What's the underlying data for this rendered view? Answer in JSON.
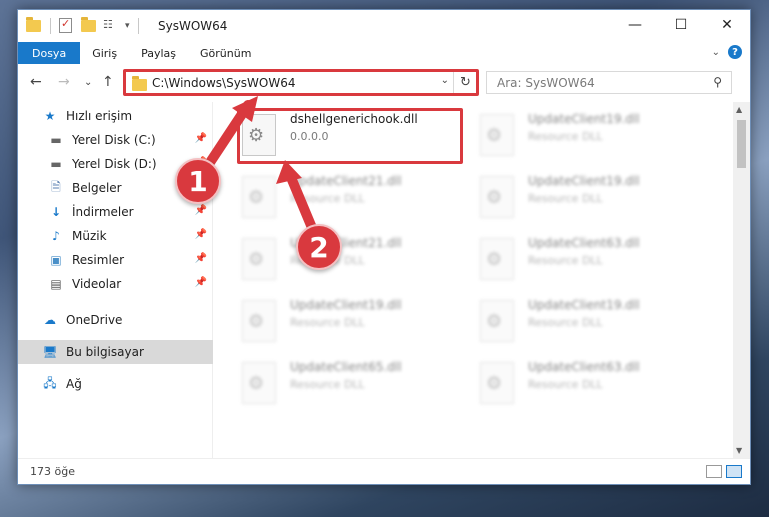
{
  "window": {
    "title": "SysWOW64",
    "minimize": "—",
    "maximize": "☐",
    "close": "✕"
  },
  "ribbon": {
    "tabs": [
      "Dosya",
      "Giriş",
      "Paylaş",
      "Görünüm"
    ]
  },
  "nav": {
    "back": "←",
    "forward": "→",
    "recent": "⌄",
    "up": "↑",
    "address": "C:\\Windows\\SysWOW64",
    "search_placeholder": "Ara: SysWOW64"
  },
  "sidebar": {
    "items": [
      {
        "label": "Hızlı erişim",
        "icon": "star-icon"
      },
      {
        "label": "Yerel Disk (C:)",
        "icon": "drive-icon",
        "pinned": true
      },
      {
        "label": "Yerel Disk (D:)",
        "icon": "drive-icon",
        "pinned": true
      },
      {
        "label": "Belgeler",
        "icon": "documents-icon",
        "pinned": true
      },
      {
        "label": "İndirmeler",
        "icon": "download-icon",
        "pinned": true
      },
      {
        "label": "Müzik",
        "icon": "music-icon",
        "pinned": true
      },
      {
        "label": "Resimler",
        "icon": "pictures-icon",
        "pinned": true
      },
      {
        "label": "Videolar",
        "icon": "videos-icon",
        "pinned": true
      },
      {
        "label": "OneDrive",
        "icon": "cloud-icon"
      },
      {
        "label": "Bu bilgisayar",
        "icon": "computer-icon",
        "selected": true
      },
      {
        "label": "Ağ",
        "icon": "network-icon"
      }
    ]
  },
  "files": {
    "highlighted": {
      "name": "dshellgenerichook.dll",
      "sub": "0.0.0.0"
    },
    "blurred": [
      {
        "name": "UpdateClient19.dll",
        "sub": "Resource DLL"
      },
      {
        "name": "UpdateClient21.dll",
        "sub": "Resource DLL"
      },
      {
        "name": "UpdateClient19.dll",
        "sub": "Resource DLL"
      },
      {
        "name": "UpdateClient21.dll",
        "sub": "Resource DLL"
      },
      {
        "name": "UpdateClient63.dll",
        "sub": "Resource DLL"
      },
      {
        "name": "UpdateClient19.dll",
        "sub": "Resource DLL"
      },
      {
        "name": "UpdateClient19.dll",
        "sub": "Resource DLL"
      },
      {
        "name": "UpdateClient65.dll",
        "sub": "Resource DLL"
      },
      {
        "name": "UpdateClient63.dll",
        "sub": "Resource DLL"
      }
    ]
  },
  "status": {
    "count": "173 öğe"
  },
  "callouts": [
    "1",
    "2"
  ],
  "colors": {
    "accent": "#1979ca",
    "highlight": "#d9393e"
  }
}
